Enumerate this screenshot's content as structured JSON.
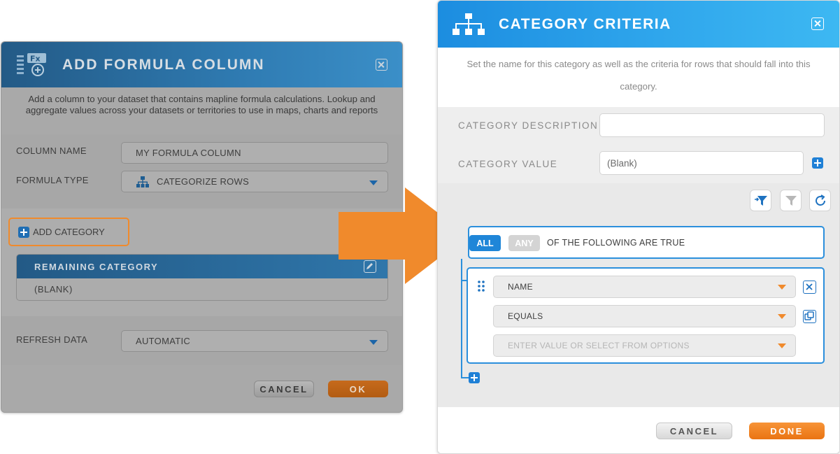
{
  "left_dialog": {
    "title": "ADD FORMULA COLUMN",
    "description": "Add a column to your dataset that contains mapline formula calculations. Lookup and aggregate values across your datasets or territories to use in maps, charts and reports",
    "column_name_label": "COLUMN NAME",
    "column_name_value": "MY FORMULA COLUMN",
    "formula_type_label": "FORMULA TYPE",
    "formula_type_value": "CATEGORIZE ROWS",
    "add_category_label": "ADD CATEGORY",
    "remaining_category_title": "REMAINING CATEGORY",
    "remaining_category_value": "(BLANK)",
    "refresh_data_label": "REFRESH DATA",
    "refresh_data_value": "AUTOMATIC",
    "cancel_label": "CANCEL",
    "ok_label": "OK"
  },
  "right_dialog": {
    "title": "CATEGORY CRITERIA",
    "description": "Set the name for this category as well as the criteria for rows that should fall into this category.",
    "category_description_label": "CATEGORY DESCRIPTION",
    "category_description_value": "",
    "category_value_label": "CATEGORY VALUE",
    "category_value_value": "(Blank)",
    "all_label": "ALL",
    "any_label": "ANY",
    "following_text": "OF THE FOLLOWING ARE TRUE",
    "rule": {
      "field": "NAME",
      "operator": "EQUALS",
      "value_placeholder": "ENTER VALUE OR SELECT FROM OPTIONS"
    },
    "cancel_label": "CANCEL",
    "done_label": "DONE"
  },
  "colors": {
    "accent_blue": "#2b8fdc",
    "accent_orange": "#f08a2c",
    "header_blue_light": "#3db8f2",
    "header_blue_dark": "#235a86"
  },
  "icons": [
    "formula-fx-icon",
    "hierarchy-icon",
    "close-icon",
    "plus-icon",
    "edit-icon",
    "chevron-down-icon",
    "filter-add-icon",
    "filter-icon",
    "refresh-icon",
    "drag-handle-icon",
    "remove-icon",
    "duplicate-icon"
  ]
}
